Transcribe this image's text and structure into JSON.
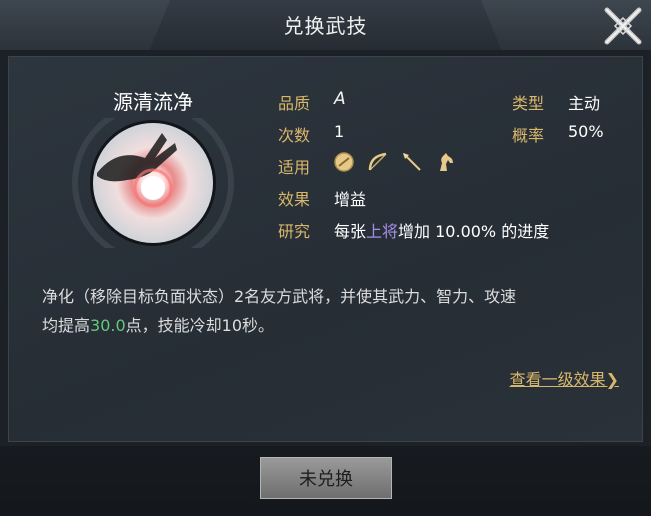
{
  "header": {
    "title": "兑换武技"
  },
  "skill": {
    "name": "源清流净",
    "quality_label": "品质",
    "quality_value": "A",
    "type_label": "类型",
    "type_value": "主动",
    "count_label": "次数",
    "count_value": "1",
    "rate_label": "概率",
    "rate_value": "50%",
    "apply_label": "适用",
    "apply_icons": [
      "shield-icon",
      "bow-icon",
      "spear-icon",
      "horse-icon"
    ],
    "effect_label": "效果",
    "effect_value": "增益",
    "research_label": "研究",
    "research_prefix": "每张",
    "research_highlight": "上将",
    "research_suffix": "增加 10.00% 的进度"
  },
  "description": {
    "line1": "净化（移除目标负面状态）2名友方武将，并使其武力、智力、攻速",
    "line2_prefix": "均提高",
    "line2_value": "30.0",
    "line2_suffix": "点，技能冷却10秒。"
  },
  "link": {
    "label": "查看一级效果"
  },
  "action": {
    "label": "未兑换"
  },
  "colors": {
    "label_gold": "#d8b76a",
    "highlight_purple": "#a48ee6",
    "highlight_green": "#63c97a",
    "background": "#1c2128"
  }
}
